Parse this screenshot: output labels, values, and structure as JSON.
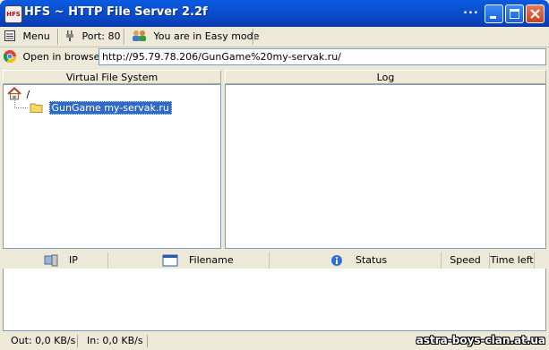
{
  "window": {
    "title": "HFS ~ HTTP File Server 2.2f",
    "app_icon_text": "HFS",
    "extra_menu": "..."
  },
  "toolbar": {
    "menu_label": "Menu",
    "port_label": "Port: 80",
    "mode_label": "You are in Easy mode"
  },
  "address": {
    "open_browser_label": "Open in browser",
    "url": "http://95.79.78.206/GunGame%20my-servak.ru/"
  },
  "panes": {
    "vfs_header": "Virtual File System",
    "log_header": "Log"
  },
  "vfs_tree": {
    "root": "/",
    "children": [
      "GunGame my-servak.ru"
    ]
  },
  "connections": {
    "columns": [
      "IP",
      "Filename",
      "Status",
      "Speed",
      "Time left"
    ]
  },
  "status": {
    "out": "Out: 0,0 KB/s",
    "in": "In: 0,0 KB/s"
  },
  "watermark": "astra-boys-clan.at.ua"
}
